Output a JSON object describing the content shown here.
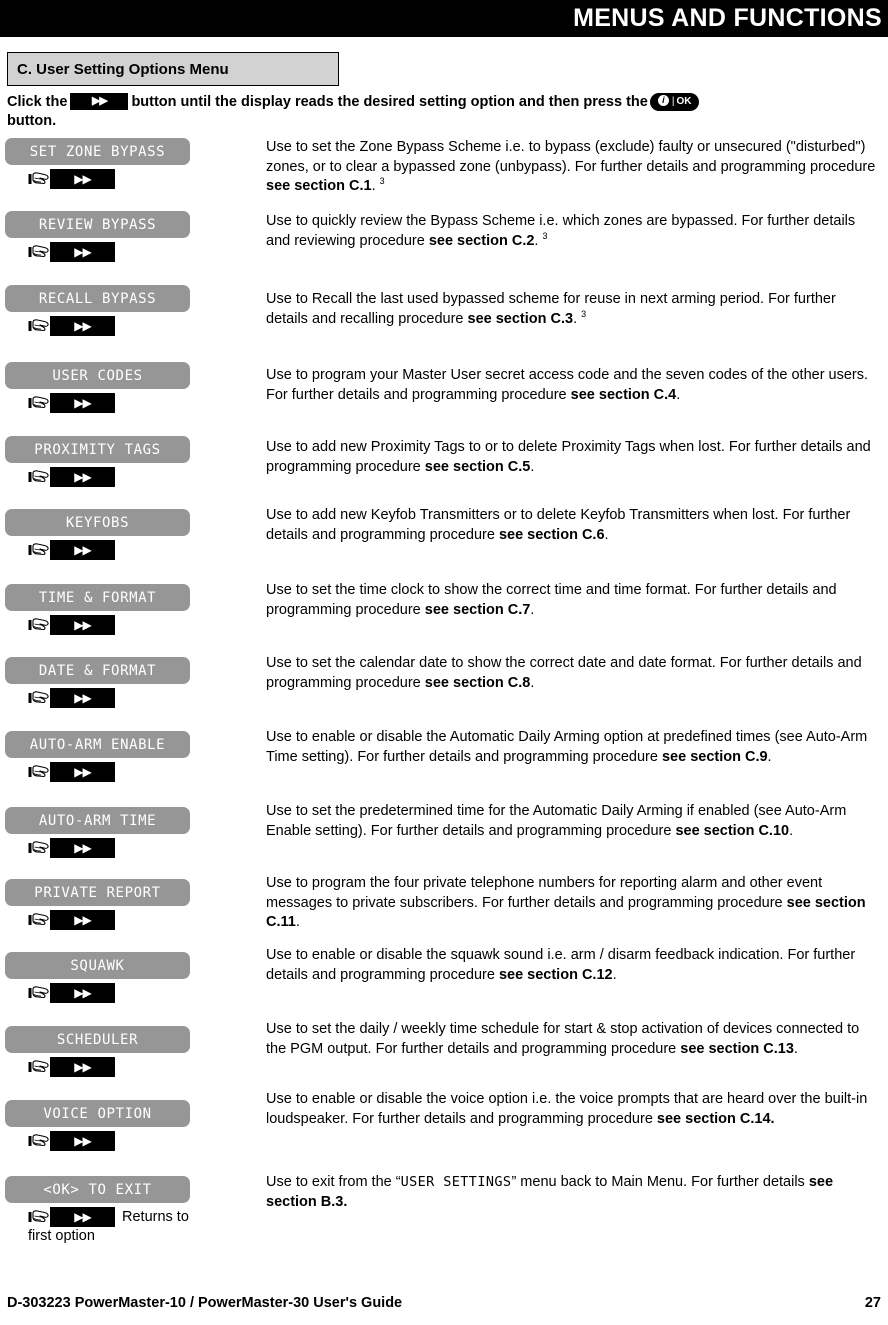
{
  "header": {
    "title": "MENUS AND FUNCTIONS"
  },
  "section": {
    "label": "C. User Setting Options Menu"
  },
  "intro": {
    "part1": "Click the",
    "ff_key_label": "▶▶",
    "part2": "button until the display reads the desired setting option and then press the",
    "ok_key_info": "i",
    "ok_key_bar": "|",
    "ok_key_label": "OK",
    "part3": "button."
  },
  "press_hint": {
    "hand_icon": "pointing-hand-icon",
    "ff_key_label": "▶▶"
  },
  "rows": [
    {
      "lcd": "SET ZONE BYPASS",
      "desc_html": "Use to set the Zone Bypass Scheme i.e. to bypass (exclude) faulty or unsecured (\"disturbed\") zones, or to clear a bypassed zone (unbypass). For further details and programming procedure <b>see section C.1</b>. <sup>3</sup>"
    },
    {
      "lcd": "REVIEW BYPASS",
      "desc_html": "Use to quickly review the Bypass Scheme i.e. which zones are bypassed. For further details and reviewing procedure <b>see section C.2</b>. <sup>3</sup>"
    },
    {
      "lcd": "RECALL BYPASS",
      "desc_html": "Use to Recall the last used bypassed scheme for reuse in next arming period. For further details and recalling procedure <b>see section C.3</b>. <sup>3</sup>"
    },
    {
      "lcd": "USER CODES",
      "desc_html": "Use to program your Master User secret access code and the seven codes of the other users. For further details and programming procedure <b>see section C.4</b>."
    },
    {
      "lcd": "PROXIMITY TAGS",
      "desc_html": "Use to add new Proximity Tags to or to delete Proximity Tags when lost. For further details and programming procedure <b>see section C.5</b>."
    },
    {
      "lcd": "KEYFOBS",
      "desc_html": "Use to add new Keyfob Transmitters or to delete Keyfob Transmitters when lost. For further details and programming procedure <b>see section C.6</b>."
    },
    {
      "lcd": "TIME & FORMAT",
      "desc_html": "Use to set the time clock to show the correct time and time format. For further details and programming procedure <b>see section C.7</b>."
    },
    {
      "lcd": "DATE & FORMAT",
      "desc_html": "Use to set the calendar date to show the correct date and date format. For further details and programming procedure <b>see section C.8</b>."
    },
    {
      "lcd": "AUTO-ARM ENABLE",
      "desc_html": "Use to enable or disable the Automatic Daily Arming option at predefined times (see Auto-Arm Time setting). For further details and programming procedure <b>see section C.9</b>."
    },
    {
      "lcd": "AUTO-ARM TIME",
      "desc_html": "Use to set the predetermined time for the Automatic Daily Arming if enabled (see Auto-Arm Enable setting). For further details and programming procedure <b>see section C.10</b>."
    },
    {
      "lcd": "PRIVATE REPORT",
      "desc_html": "Use to program the four private telephone numbers for reporting alarm and other event messages to private subscribers. For further details and programming procedure <b>see section C.11</b>."
    },
    {
      "lcd": "SQUAWK",
      "desc_html": "Use to enable or disable the squawk sound i.e. arm / disarm feedback indication. For further details and programming procedure <b>see section C.12</b>."
    },
    {
      "lcd": "SCHEDULER",
      "desc_html": "Use to set the daily / weekly time schedule for start &amp; stop activation of devices connected to the PGM output. For further details and programming procedure <b>see section C.13</b>."
    },
    {
      "lcd": "VOICE OPTION",
      "desc_html": "Use to enable or disable the voice option i.e. the voice prompts that are heard over the built-in loudspeaker. For further details and programming procedure <b>see section C.14.</b>"
    },
    {
      "lcd": "<OK> TO EXIT",
      "desc_html": "Use to exit from the “<span class=\"lcd-inline\">USER SETTINGS</span>” menu back to Main Menu. For further details <b>see section B.3.</b>",
      "returns_note_line1": "Returns to",
      "returns_note_line2": "first option"
    }
  ],
  "footer": {
    "left": "D-303223 PowerMaster-10 / PowerMaster-30 User's Guide",
    "right": "27"
  },
  "colors": {
    "header_bar": "#000000",
    "section_box": "#d2d2d2",
    "lcd_pill": "#969696",
    "key_black": "#000000",
    "text": "#000000"
  }
}
